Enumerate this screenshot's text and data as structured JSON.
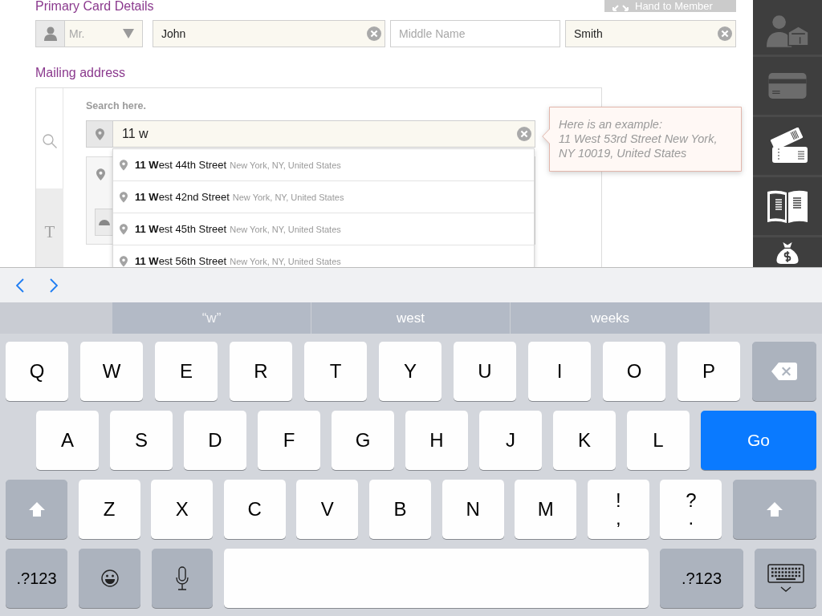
{
  "header": {
    "title": "Primary Card Details",
    "hand_button": "Hand to Member"
  },
  "name_fields": [
    {
      "kind": "select",
      "placeholder": "Mr."
    },
    {
      "kind": "text",
      "value": "John"
    },
    {
      "kind": "text",
      "placeholder": "Middle Name"
    },
    {
      "kind": "text",
      "value": "Smith"
    }
  ],
  "mailing": {
    "heading": "Mailing address",
    "side_tabs": [
      {
        "kind": "search",
        "selected": true
      },
      {
        "kind": "text",
        "label": "T",
        "selected": false
      }
    ],
    "search_label": "Search here.",
    "search_value": "11 w",
    "suggestions": [
      {
        "main": "**11 W**est 44th Street",
        "detail": "New York, NY, United States"
      },
      {
        "main": "**11 W**est 42nd Street",
        "detail": "New York, NY, United States"
      },
      {
        "main": "**11 W**est 45th Street",
        "detail": "New York, NY, United States"
      },
      {
        "main": "**11 W**est 56th Street",
        "detail": "New York, NY, United States"
      }
    ],
    "tip": {
      "title": "Here is an example:",
      "text": "11 West 53rd Street New York, NY 10019, United States"
    }
  },
  "sidebar": {
    "items": [
      {
        "disabled": true
      },
      {
        "disabled": true
      },
      {
        "disabled": false
      },
      {
        "disabled": false
      },
      {
        "disabled": false
      }
    ]
  },
  "keyboard": {
    "suggestions": [
      {
        "kind": "typed",
        "text": "“w”"
      },
      {
        "kind": "word",
        "text": "west"
      },
      {
        "kind": "word",
        "text": "weeks"
      }
    ],
    "rows": [
      {
        "keys": [
          {
            "kind": "char",
            "label": "Q"
          },
          {
            "kind": "char",
            "label": "W"
          },
          {
            "kind": "char",
            "label": "E"
          },
          {
            "kind": "char",
            "label": "R"
          },
          {
            "kind": "char",
            "label": "T"
          },
          {
            "kind": "char",
            "label": "Y"
          },
          {
            "kind": "char",
            "label": "U"
          },
          {
            "kind": "char",
            "label": "I"
          },
          {
            "kind": "char",
            "label": "O"
          },
          {
            "kind": "char",
            "label": "P"
          },
          {
            "kind": "backspace"
          }
        ]
      },
      {
        "keys": [
          {
            "kind": "char",
            "label": "A"
          },
          {
            "kind": "char",
            "label": "S"
          },
          {
            "kind": "char",
            "label": "D"
          },
          {
            "kind": "char",
            "label": "F"
          },
          {
            "kind": "char",
            "label": "G"
          },
          {
            "kind": "char",
            "label": "H"
          },
          {
            "kind": "char",
            "label": "J"
          },
          {
            "kind": "char",
            "label": "K"
          },
          {
            "kind": "char",
            "label": "L"
          },
          {
            "kind": "go",
            "label": "Go"
          }
        ]
      },
      {
        "keys": [
          {
            "kind": "shift"
          },
          {
            "kind": "char",
            "label": "Z"
          },
          {
            "kind": "char",
            "label": "X"
          },
          {
            "kind": "char",
            "label": "C"
          },
          {
            "kind": "char",
            "label": "V"
          },
          {
            "kind": "char",
            "label": "B"
          },
          {
            "kind": "char",
            "label": "N"
          },
          {
            "kind": "char",
            "label": "M"
          },
          {
            "kind": "char",
            "label": "!",
            "alt": ","
          },
          {
            "kind": "char",
            "label": "?",
            "alt": "."
          },
          {
            "kind": "shift"
          }
        ]
      },
      {
        "keys": [
          {
            "kind": "symbols",
            "label": ".?123"
          },
          {
            "kind": "emoji"
          },
          {
            "kind": "dictation"
          },
          {
            "kind": "space"
          },
          {
            "kind": "symbols",
            "label": ".?123"
          },
          {
            "kind": "dismiss"
          }
        ]
      }
    ]
  }
}
